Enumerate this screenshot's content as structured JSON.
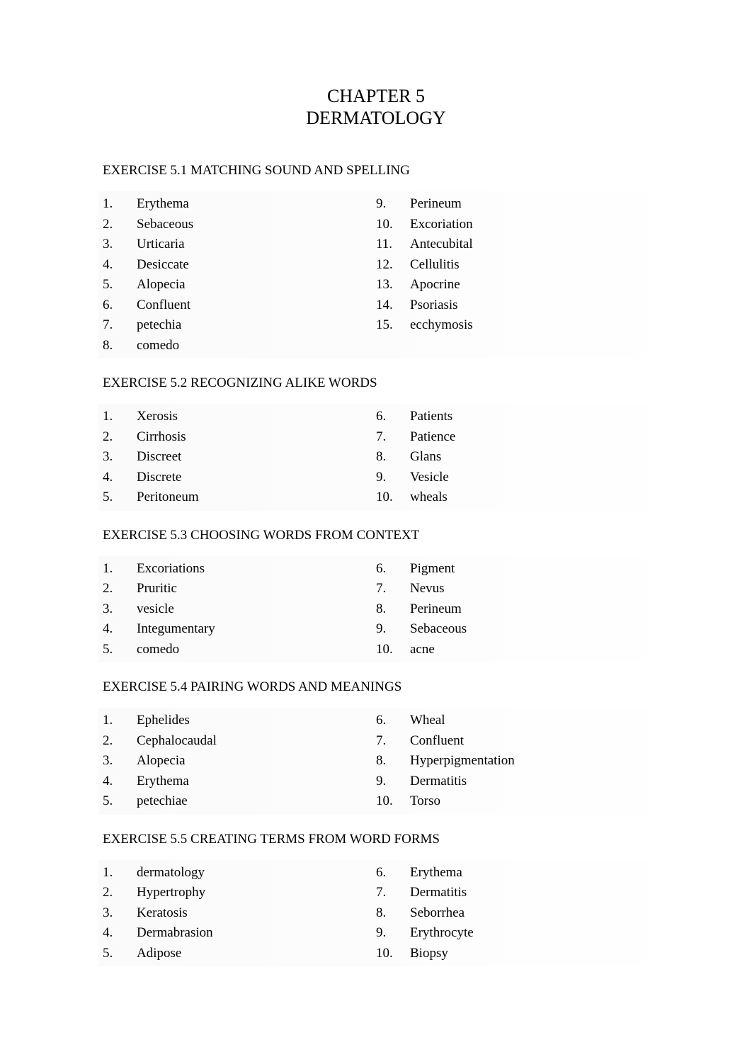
{
  "header": {
    "chapter_number": "CHAPTER 5",
    "chapter_title": "DERMATOLOGY"
  },
  "exercises": [
    {
      "title": "EXERCISE 5.1 MATCHING SOUND AND SPELLING",
      "left": [
        {
          "num": "1.",
          "text": "Erythema"
        },
        {
          "num": "2.",
          "text": "Sebaceous"
        },
        {
          "num": "3.",
          "text": "Urticaria"
        },
        {
          "num": "4.",
          "text": "Desiccate"
        },
        {
          "num": "5.",
          "text": "Alopecia"
        },
        {
          "num": "6.",
          "text": "Confluent"
        },
        {
          "num": "7.",
          "text": "petechia"
        },
        {
          "num": "8.",
          "text": "comedo"
        }
      ],
      "right": [
        {
          "num": "9.",
          "text": "Perineum"
        },
        {
          "num": "10.",
          "text": "Excoriation"
        },
        {
          "num": "11.",
          "text": "Antecubital"
        },
        {
          "num": "12.",
          "text": "Cellulitis"
        },
        {
          "num": "13.",
          "text": "Apocrine"
        },
        {
          "num": "14.",
          "text": "Psoriasis"
        },
        {
          "num": "15.",
          "text": "ecchymosis"
        }
      ]
    },
    {
      "title": "EXERCISE 5.2 RECOGNIZING ALIKE WORDS",
      "left": [
        {
          "num": "1.",
          "text": "Xerosis"
        },
        {
          "num": "2.",
          "text": "Cirrhosis"
        },
        {
          "num": "3.",
          "text": "Discreet"
        },
        {
          "num": "4.",
          "text": "Discrete"
        },
        {
          "num": "5.",
          "text": "Peritoneum"
        }
      ],
      "right": [
        {
          "num": "6.",
          "text": "Patients"
        },
        {
          "num": "7.",
          "text": "Patience"
        },
        {
          "num": "8.",
          "text": "Glans"
        },
        {
          "num": "9.",
          "text": "Vesicle"
        },
        {
          "num": "10.",
          "text": "wheals"
        }
      ]
    },
    {
      "title": "EXERCISE 5.3 CHOOSING WORDS FROM CONTEXT",
      "left": [
        {
          "num": "1.",
          "text": "Excoriations"
        },
        {
          "num": "2.",
          "text": "Pruritic"
        },
        {
          "num": "3.",
          "text": "vesicle"
        },
        {
          "num": "4.",
          "text": "Integumentary"
        },
        {
          "num": "5.",
          "text": "comedo"
        }
      ],
      "right": [
        {
          "num": "6.",
          "text": "Pigment"
        },
        {
          "num": "7.",
          "text": "Nevus"
        },
        {
          "num": "8.",
          "text": "Perineum"
        },
        {
          "num": "9.",
          "text": "Sebaceous"
        },
        {
          "num": "10.",
          "text": "acne"
        }
      ]
    },
    {
      "title": "EXERCISE 5.4 PAIRING WORDS AND MEANINGS",
      "left": [
        {
          "num": "1.",
          "text": "Ephelides"
        },
        {
          "num": "2.",
          "text": "Cephalocaudal"
        },
        {
          "num": "3.",
          "text": "Alopecia"
        },
        {
          "num": "4.",
          "text": "Erythema"
        },
        {
          "num": "5.",
          "text": "petechiae"
        }
      ],
      "right": [
        {
          "num": "6.",
          "text": "Wheal"
        },
        {
          "num": "7.",
          "text": "Confluent"
        },
        {
          "num": "8.",
          "text": "Hyperpigmentation"
        },
        {
          "num": "9.",
          "text": "Dermatitis"
        },
        {
          "num": "10.",
          "text": "Torso"
        }
      ]
    },
    {
      "title": "EXERCISE 5.5 CREATING TERMS FROM WORD FORMS",
      "left": [
        {
          "num": "1.",
          "text": "dermatology"
        },
        {
          "num": "2.",
          "text": "Hypertrophy"
        },
        {
          "num": "3.",
          "text": "Keratosis"
        },
        {
          "num": "4.",
          "text": "Dermabrasion"
        },
        {
          "num": "5.",
          "text": "Adipose"
        }
      ],
      "right": [
        {
          "num": "6.",
          "text": "Erythema"
        },
        {
          "num": "7.",
          "text": "Dermatitis"
        },
        {
          "num": "8.",
          "text": "Seborrhea"
        },
        {
          "num": "9.",
          "text": "Erythrocyte"
        },
        {
          "num": "10.",
          "text": "Biopsy"
        }
      ]
    }
  ]
}
